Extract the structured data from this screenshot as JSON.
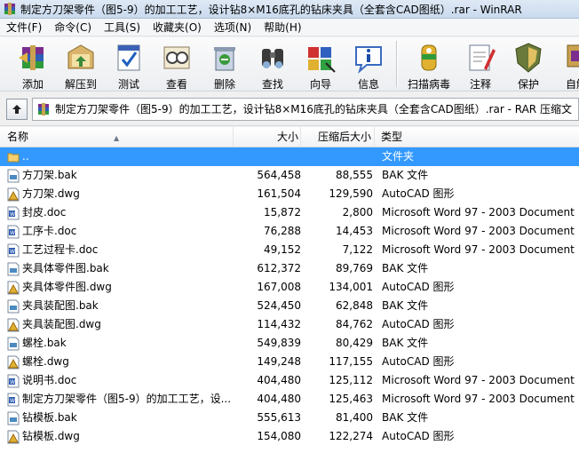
{
  "window": {
    "title": "制定方刀架零件（图5-9）的加工工艺，设计钻8×M16底孔的钻床夹具（全套含CAD图纸）.rar - WinRAR"
  },
  "menu": [
    {
      "label": "文件(F)"
    },
    {
      "label": "命令(C)"
    },
    {
      "label": "工具(S)"
    },
    {
      "label": "收藏夹(O)"
    },
    {
      "label": "选项(N)"
    },
    {
      "label": "帮助(H)"
    }
  ],
  "toolbar": [
    {
      "label": "添加",
      "icon": "add-icon"
    },
    {
      "label": "解压到",
      "icon": "extract-to-icon"
    },
    {
      "label": "测试",
      "icon": "test-icon"
    },
    {
      "label": "查看",
      "icon": "view-icon"
    },
    {
      "label": "删除",
      "icon": "delete-icon"
    },
    {
      "label": "查找",
      "icon": "find-icon"
    },
    {
      "label": "向导",
      "icon": "wizard-icon"
    },
    {
      "label": "信息",
      "icon": "info-icon"
    },
    {
      "label": "扫描病毒",
      "icon": "virus-scan-icon"
    },
    {
      "label": "注释",
      "icon": "comment-icon"
    },
    {
      "label": "保护",
      "icon": "protect-icon"
    },
    {
      "label": "自解",
      "icon": "sfx-icon"
    }
  ],
  "address": {
    "path": "制定方刀架零件（图5-9）的加工工艺，设计钻8×M16底孔的钻床夹具（全套含CAD图纸）.rar - RAR 压缩文"
  },
  "columns": {
    "name": "名称",
    "size": "大小",
    "packed": "压缩后大小",
    "type": "类型"
  },
  "files": [
    {
      "name": "..",
      "size": "",
      "packed": "",
      "type": "文件夹",
      "icon": "folder-up-icon",
      "selected": true
    },
    {
      "name": "方刀架.bak",
      "size": "564,458",
      "packed": "88,555",
      "type": "BAK 文件",
      "icon": "bak-file-icon"
    },
    {
      "name": "方刀架.dwg",
      "size": "161,504",
      "packed": "129,590",
      "type": "AutoCAD 图形",
      "icon": "dwg-file-icon"
    },
    {
      "name": "封皮.doc",
      "size": "15,872",
      "packed": "2,800",
      "type": "Microsoft Word 97 - 2003 Document",
      "icon": "doc-file-icon"
    },
    {
      "name": "工序卡.doc",
      "size": "76,288",
      "packed": "14,453",
      "type": "Microsoft Word 97 - 2003 Document",
      "icon": "doc-file-icon"
    },
    {
      "name": "工艺过程卡.doc",
      "size": "49,152",
      "packed": "7,122",
      "type": "Microsoft Word 97 - 2003 Document",
      "icon": "doc-file-icon"
    },
    {
      "name": "夹具体零件图.bak",
      "size": "612,372",
      "packed": "89,769",
      "type": "BAK 文件",
      "icon": "bak-file-icon"
    },
    {
      "name": "夹具体零件图.dwg",
      "size": "167,008",
      "packed": "134,001",
      "type": "AutoCAD 图形",
      "icon": "dwg-file-icon"
    },
    {
      "name": "夹具装配图.bak",
      "size": "524,450",
      "packed": "62,848",
      "type": "BAK 文件",
      "icon": "bak-file-icon"
    },
    {
      "name": "夹具装配图.dwg",
      "size": "114,432",
      "packed": "84,762",
      "type": "AutoCAD 图形",
      "icon": "dwg-file-icon"
    },
    {
      "name": "螺栓.bak",
      "size": "549,839",
      "packed": "80,429",
      "type": "BAK 文件",
      "icon": "bak-file-icon"
    },
    {
      "name": "螺栓.dwg",
      "size": "149,248",
      "packed": "117,155",
      "type": "AutoCAD 图形",
      "icon": "dwg-file-icon"
    },
    {
      "name": "说明书.doc",
      "size": "404,480",
      "packed": "125,112",
      "type": "Microsoft Word 97 - 2003 Document",
      "icon": "doc-file-icon"
    },
    {
      "name": "制定方刀架零件（图5-9）的加工工艺，设...",
      "size": "404,480",
      "packed": "125,463",
      "type": "Microsoft Word 97 - 2003 Document",
      "icon": "doc-file-icon"
    },
    {
      "name": "钻模板.bak",
      "size": "555,613",
      "packed": "81,400",
      "type": "BAK 文件",
      "icon": "bak-file-icon"
    },
    {
      "name": "钻模板.dwg",
      "size": "154,080",
      "packed": "122,274",
      "type": "AutoCAD 图形",
      "icon": "dwg-file-icon"
    }
  ]
}
